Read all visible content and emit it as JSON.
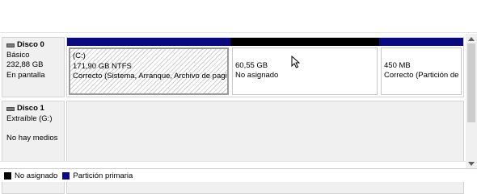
{
  "colors": {
    "unallocated": "#000000",
    "primary_partition": "#0a0a80"
  },
  "disks": [
    {
      "name": "Disco 0",
      "type": "Básico",
      "size": "232,88 GB",
      "status": "En pantalla",
      "icon": "hard-disk-icon",
      "partitions": [
        {
          "kind": "primary",
          "label": "(C:)",
          "size": "171,90 GB NTFS",
          "status": "Correcto (Sistema, Arranque, Archivo de pagir"
        },
        {
          "kind": "unallocated",
          "label": "",
          "size": "60,55 GB",
          "status": "No asignado"
        },
        {
          "kind": "primary",
          "label": "",
          "size": "450 MB",
          "status": "Correcto (Partición de"
        }
      ]
    },
    {
      "name": "Disco 1",
      "type": "Extraíble (G:)",
      "status": "No hay medios",
      "icon": "removable-disk-icon"
    }
  ],
  "legend": [
    {
      "label": "No asignado",
      "color": "#000000"
    },
    {
      "label": "Partición primaria",
      "color": "#0a0a80"
    }
  ]
}
